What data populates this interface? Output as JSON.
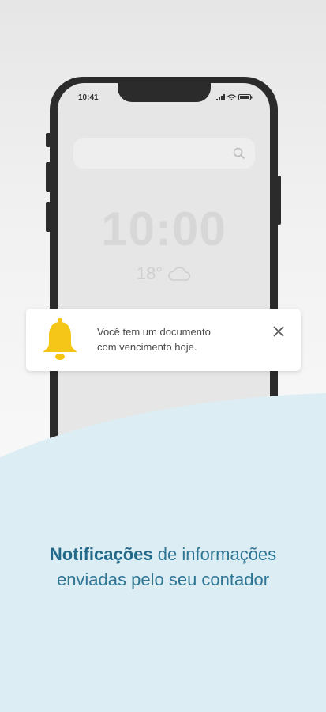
{
  "phone": {
    "status_time": "10:41",
    "clock": "10:00",
    "temperature": "18°",
    "weather_icon": "cloud-icon"
  },
  "notification": {
    "line1": "Você tem um documento",
    "line2": "com vencimento hoje.",
    "icon": "bell-icon",
    "close_icon": "close-icon"
  },
  "caption": {
    "highlight": "Notificações",
    "rest_line1": " de informações",
    "line2": "enviadas pelo seu contador"
  },
  "colors": {
    "accent": "#236a8a",
    "bell": "#f5c518",
    "wave": "#dceef4"
  }
}
